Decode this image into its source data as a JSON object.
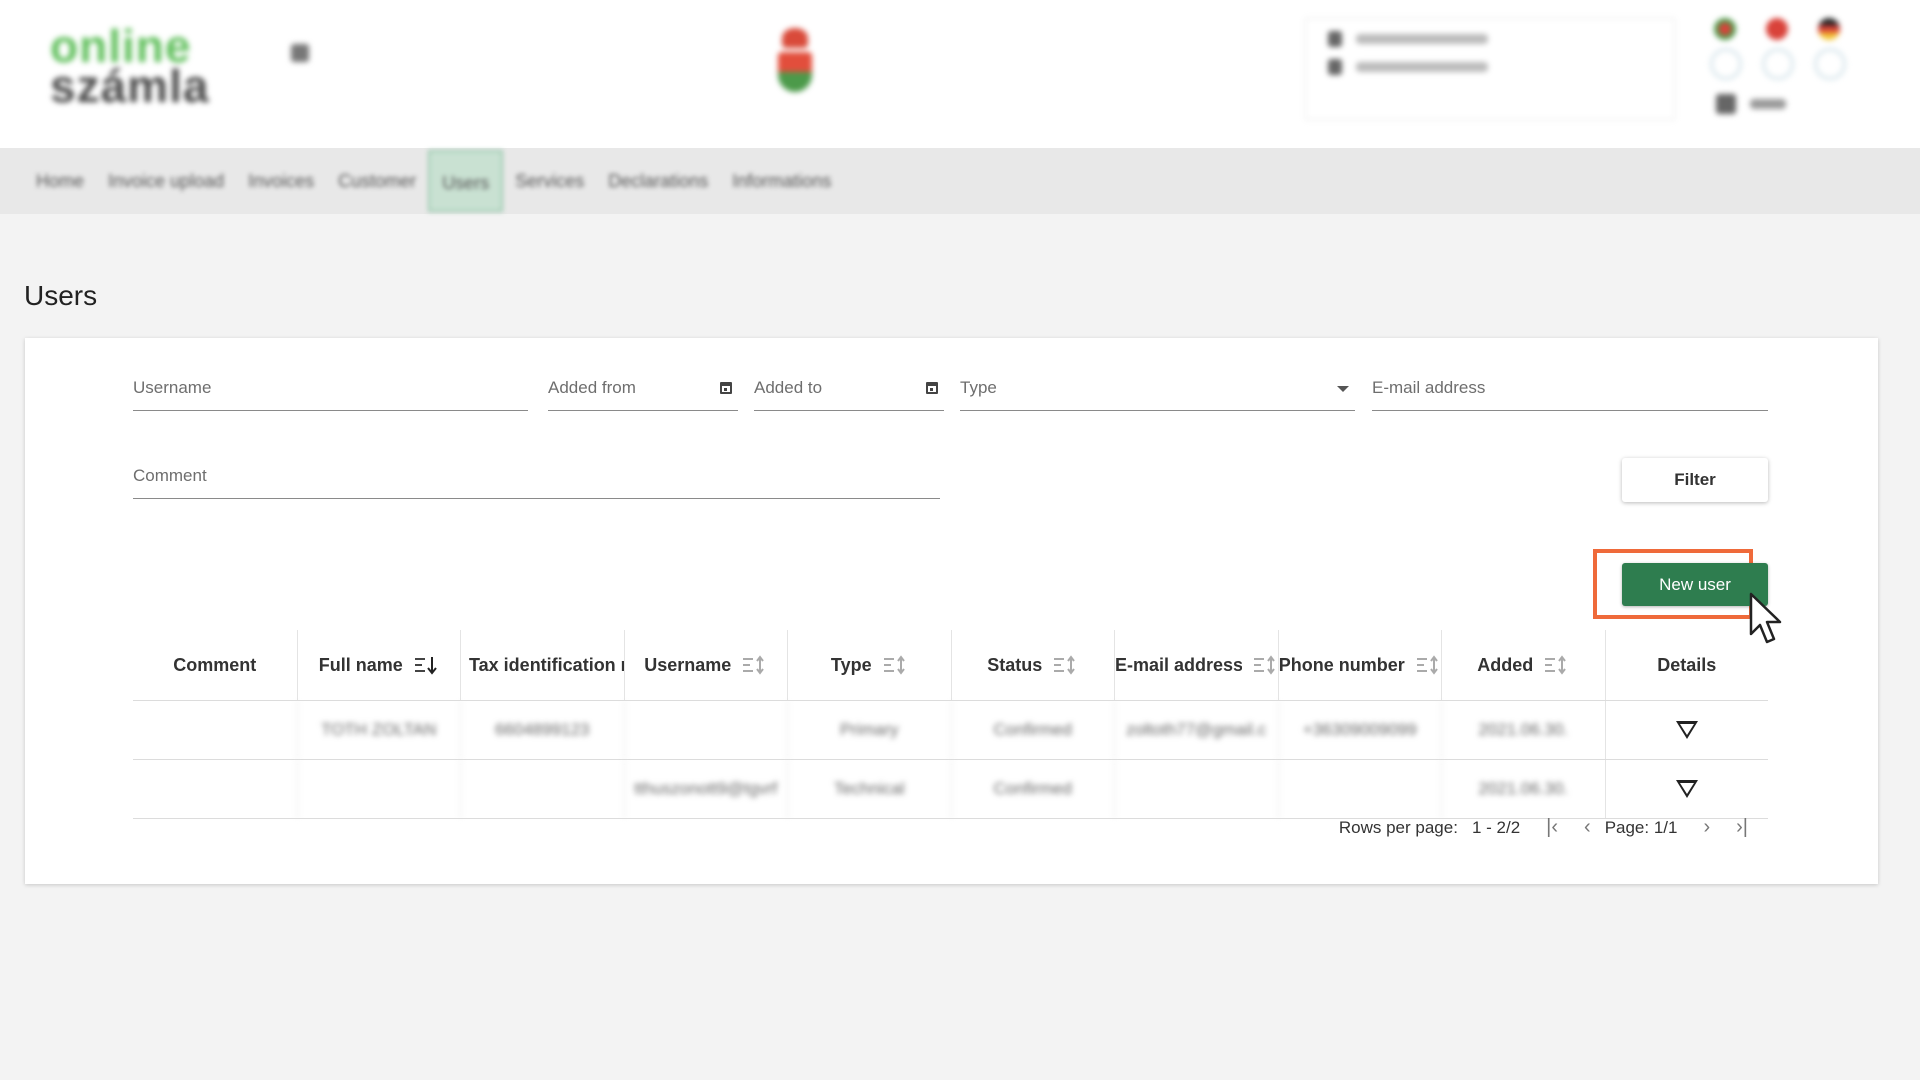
{
  "page": {
    "title": "Users"
  },
  "nav": {
    "items": [
      {
        "label": "Home",
        "active": false
      },
      {
        "label": "Invoice upload",
        "active": false
      },
      {
        "label": "Invoices",
        "active": false
      },
      {
        "label": "Customer",
        "active": false
      },
      {
        "label": "Users",
        "active": true
      },
      {
        "label": "Services",
        "active": false
      },
      {
        "label": "Declarations",
        "active": false
      },
      {
        "label": "Informations",
        "active": false
      }
    ]
  },
  "filters": {
    "username_placeholder": "Username",
    "added_from_placeholder": "Added from",
    "added_to_placeholder": "Added to",
    "type_placeholder": "Type",
    "email_placeholder": "E-mail address",
    "comment_placeholder": "Comment",
    "filter_label": "Filter"
  },
  "actions": {
    "new_user_label": "New user"
  },
  "table": {
    "headers": [
      "Comment",
      "Full name",
      "Tax identification n",
      "Username",
      "Type",
      "Status",
      "E-mail address",
      "Phone number",
      "Added",
      "Details"
    ],
    "rows": [
      [
        "",
        "TOTH ZOLTAN",
        "6604899123",
        "",
        "Primary",
        "Confirmed",
        "zoltoth77@gmail.c",
        "+36309009099",
        "2021.06.30.",
        ""
      ],
      [
        "",
        "",
        "",
        "tthuszonott9@tgvrf",
        "Technical",
        "Confirmed",
        "",
        "",
        "2021.06.30.",
        ""
      ]
    ]
  },
  "pagination": {
    "rows_per_page_label": "Rows per page:",
    "range": "1 - 2/2",
    "page": "Page: 1/1"
  },
  "colors": {
    "primary_green": "#2e7d4f",
    "highlight_orange": "#ef6a3a",
    "nav_active": "#c9e1d2"
  },
  "icons": {
    "date": "calendar-icon",
    "dropdown": "chevron-down-icon",
    "sort": "sort-icon",
    "details": "expand-triangle-icon",
    "pointer": "hand-cursor-icon"
  }
}
